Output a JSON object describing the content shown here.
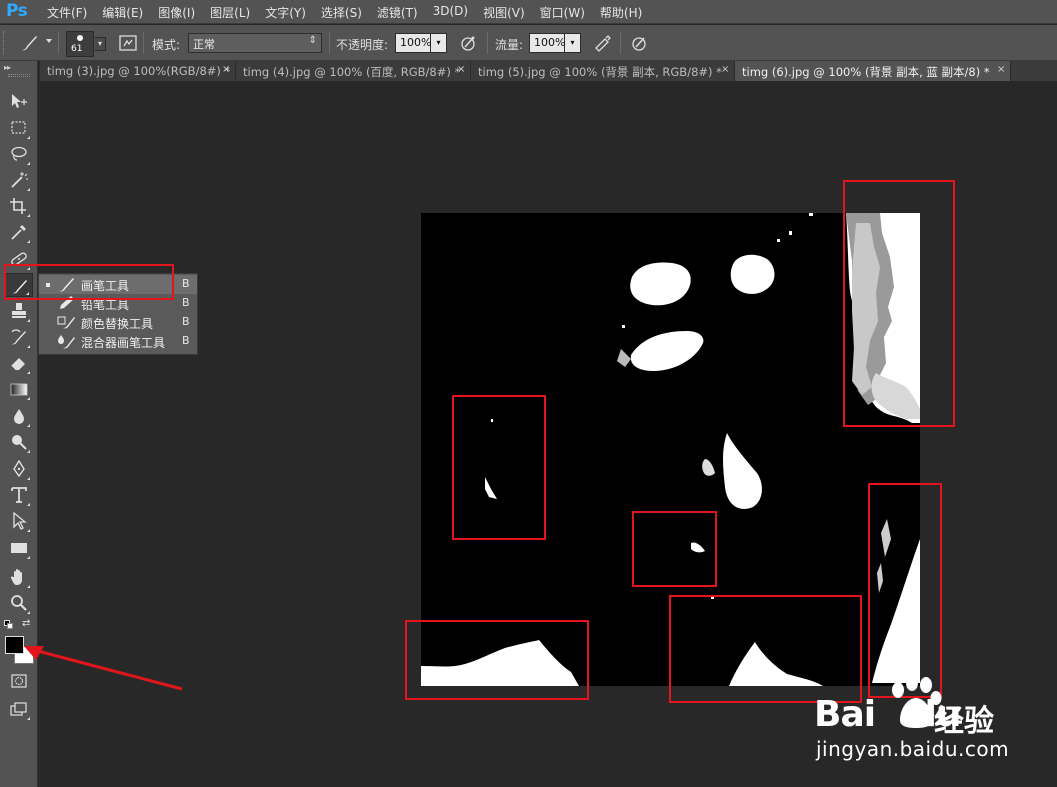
{
  "app": {
    "logo": "Ps"
  },
  "menu": [
    "文件(F)",
    "编辑(E)",
    "图像(I)",
    "图层(L)",
    "文字(Y)",
    "选择(S)",
    "滤镜(T)",
    "3D(D)",
    "视图(V)",
    "窗口(W)",
    "帮助(H)"
  ],
  "options": {
    "brush_size": "61",
    "mode_label": "模式:",
    "mode_value": "正常",
    "opacity_label": "不透明度:",
    "opacity_value": "100%",
    "flow_label": "流量:",
    "flow_value": "100%"
  },
  "tabs": [
    {
      "label": "timg (3).jpg @ 100%(RGB/8#) *",
      "active": false
    },
    {
      "label": "timg (4).jpg @ 100% (百度, RGB/8#) *",
      "active": false
    },
    {
      "label": "timg (5).jpg @ 100% (背景 副本, RGB/8#) *",
      "active": false
    },
    {
      "label": "timg (6).jpg @ 100% (背景 副本, 蓝 副本/8) *",
      "active": true
    }
  ],
  "tab_close": "×",
  "flyout": {
    "items": [
      {
        "label": "画笔工具",
        "key": "B",
        "selected": true
      },
      {
        "label": "铅笔工具",
        "key": "B",
        "selected": false
      },
      {
        "label": "颜色替换工具",
        "key": "B",
        "selected": false
      },
      {
        "label": "混合器画笔工具",
        "key": "B",
        "selected": false
      }
    ]
  },
  "tools": [
    "move-tool",
    "marquee-tool",
    "lasso-tool",
    "magic-wand-tool",
    "crop-tool",
    "eyedropper-tool",
    "healing-brush-tool",
    "brush-tool",
    "clone-stamp-tool",
    "history-brush-tool",
    "eraser-tool",
    "gradient-tool",
    "blur-tool",
    "dodge-tool",
    "pen-tool",
    "type-tool",
    "path-selection-tool",
    "rectangle-tool",
    "hand-tool",
    "zoom-tool"
  ],
  "colors": {
    "foreground": "#000000",
    "background": "#ffffff",
    "annotation": "#e0161c",
    "ps_blue": "#31a8ff"
  },
  "watermark": {
    "brand": "Bai",
    "brand_suffix": "du",
    "product": "经验",
    "url": "jingyan.baidu.com"
  }
}
